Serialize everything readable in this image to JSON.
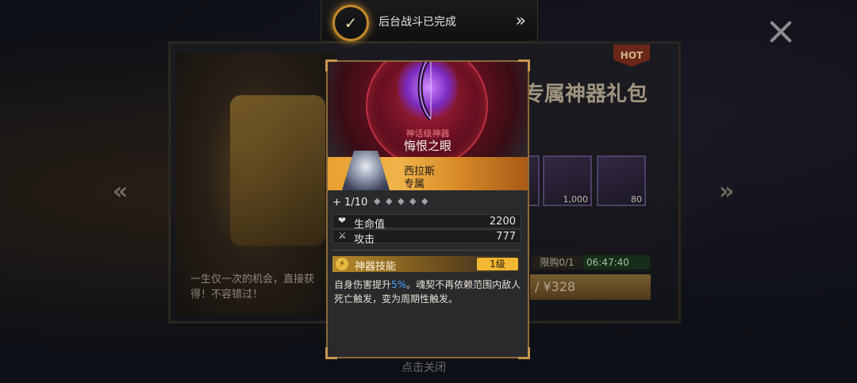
{
  "toast": {
    "text": "后台战斗已完成",
    "check_glyph": "✓",
    "arrow_glyph": "»"
  },
  "background": {
    "hot_badge": "HOT",
    "title": "专属神器礼包",
    "item_counts": [
      "1,000",
      "80"
    ],
    "purchase_limit": "限购0/1",
    "timer": "06:47:40",
    "price": "/ ¥328",
    "description": "一生仅一次的机会，直接获得！不容错过！",
    "close_hint": "点击关闭",
    "nav_left": "«",
    "nav_right": "»"
  },
  "card": {
    "tier": "神话级神器",
    "name": "悔恨之眼",
    "hero": {
      "name": "西拉斯",
      "tag": "专属"
    },
    "level": "+ 1/10",
    "gems": [
      "◆",
      "◆",
      "◆",
      "◆",
      "◆"
    ],
    "stats": [
      {
        "icon": "heart-icon",
        "glyph": "❤",
        "label": "生命值",
        "value": "2200"
      },
      {
        "icon": "sword-icon",
        "glyph": "⚔",
        "label": "攻击",
        "value": "777"
      }
    ],
    "skill": {
      "icon_glyph": "⚡",
      "title": "神器技能",
      "level": "1级",
      "desc_pre": "自身伤害提升",
      "desc_highlight": "5%",
      "desc_post": "。魂契不再依赖范围内敌人死亡触发，变为周期性触发。"
    }
  },
  "colors": {
    "accent_gold": "#c9974d",
    "highlight_blue": "#4aa8ff",
    "mythic_red": "#b0213a"
  }
}
